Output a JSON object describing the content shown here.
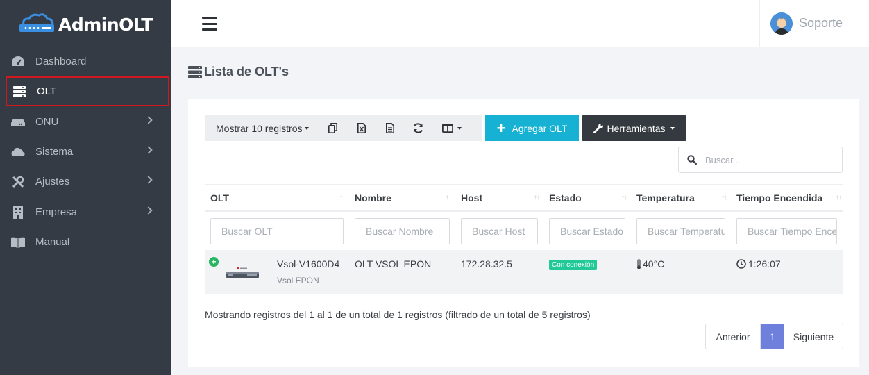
{
  "brand": {
    "name": "AdminOLT"
  },
  "sidebar": {
    "items": [
      {
        "label": "Dashboard",
        "icon": "dashboard-icon",
        "has_chevron": false
      },
      {
        "label": "OLT",
        "icon": "server-icon",
        "has_chevron": false,
        "active": true
      },
      {
        "label": "ONU",
        "icon": "hdd-icon",
        "has_chevron": true
      },
      {
        "label": "Sistema",
        "icon": "cloud-icon",
        "has_chevron": true
      },
      {
        "label": "Ajustes",
        "icon": "tools-icon",
        "has_chevron": true
      },
      {
        "label": "Empresa",
        "icon": "building-icon",
        "has_chevron": true
      },
      {
        "label": "Manual",
        "icon": "book-icon",
        "has_chevron": false
      }
    ]
  },
  "header": {
    "user_name": "Soporte"
  },
  "page": {
    "title": "Lista de OLT's"
  },
  "toolbar": {
    "length_label": "Mostrar 10 registros",
    "add_label": "Agregar OLT",
    "tools_label": "Herramientas"
  },
  "search": {
    "placeholder": "Buscar..."
  },
  "table": {
    "columns": [
      {
        "label": "OLT",
        "filter_placeholder": "Buscar OLT"
      },
      {
        "label": "Nombre",
        "filter_placeholder": "Buscar Nombre"
      },
      {
        "label": "Host",
        "filter_placeholder": "Buscar Host"
      },
      {
        "label": "Estado",
        "filter_placeholder": "Buscar Estado"
      },
      {
        "label": "Temperatura",
        "filter_placeholder": "Buscar Temperatura"
      },
      {
        "label": "Tiempo Encendida",
        "filter_placeholder": "Buscar Tiempo Encendida"
      }
    ],
    "rows": [
      {
        "model": "Vsol-V1600D4",
        "model_sub": "Vsol EPON",
        "name": "OLT VSOL EPON",
        "host": "172.28.32.5",
        "status": "Con conexión",
        "temperature": "40°C",
        "uptime": "1:26:07"
      }
    ]
  },
  "footer": {
    "info": "Mostrando registros del 1 al 1 de un total de 1 registros (filtrado de un total de 5 registros)",
    "pagination": {
      "prev": "Anterior",
      "current": "1",
      "next": "Siguiente"
    }
  },
  "colors": {
    "accent": "#17b2d3",
    "sidebar_bg": "#343b44",
    "active_border": "#d0191e",
    "status_ok": "#20c997",
    "page_active": "#6f7fdc"
  }
}
